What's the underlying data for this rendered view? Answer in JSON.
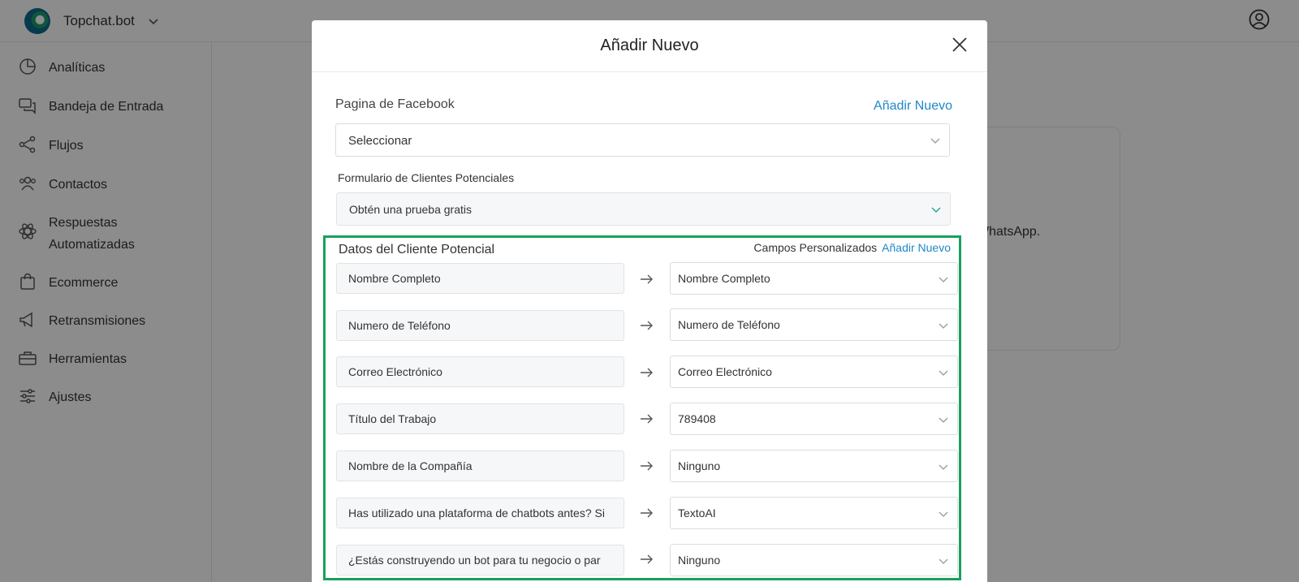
{
  "app": {
    "name": "Topchat.bot"
  },
  "sidebar": {
    "items": [
      {
        "label": "Analíticas",
        "icon": "chart-pie-icon"
      },
      {
        "label": "Bandeja de Entrada",
        "icon": "chat-bubbles-icon"
      },
      {
        "label": "Flujos",
        "icon": "share-nodes-icon"
      },
      {
        "label": "Contactos",
        "icon": "users-icon"
      },
      {
        "label": "Respuestas Automatizadas",
        "icon": "atom-icon"
      },
      {
        "label": "Ecommerce",
        "icon": "shopping-bag-icon"
      },
      {
        "label": "Retransmisiones",
        "icon": "megaphone-icon"
      },
      {
        "label": "Herramientas",
        "icon": "toolbox-icon"
      },
      {
        "label": "Ajustes",
        "icon": "sliders-icon"
      }
    ]
  },
  "background": {
    "card_text": "WhatsApp."
  },
  "modal": {
    "title": "Añadir Nuevo",
    "facebook_page_label": "Pagina de Facebook",
    "add_new_link": "Añadir Nuevo",
    "facebook_page_value": "Seleccionar",
    "lead_form_label": "Formulario de Clientes Potenciales",
    "lead_form_value": "Obtén una prueba gratis",
    "lead_data": {
      "title": "Datos del Cliente Potencial",
      "custom_fields_label": "Campos Personalizados",
      "custom_fields_add": "Añadir Nuevo",
      "rows": [
        {
          "source": "Nombre Completo",
          "target": "Nombre Completo"
        },
        {
          "source": "Numero de Teléfono",
          "target": "Numero de Teléfono"
        },
        {
          "source": "Correo Electrónico",
          "target": "Correo Electrónico"
        },
        {
          "source": "Título del Trabajo",
          "target": "789408"
        },
        {
          "source": "Nombre de la Compañía",
          "target": "Ninguno"
        },
        {
          "source": "Has utilizado una plataforma de chatbots antes? Si",
          "target": "TextoAI"
        },
        {
          "source": "¿Estás construyendo un bot para tu negocio o par",
          "target": "Ninguno"
        }
      ]
    }
  }
}
